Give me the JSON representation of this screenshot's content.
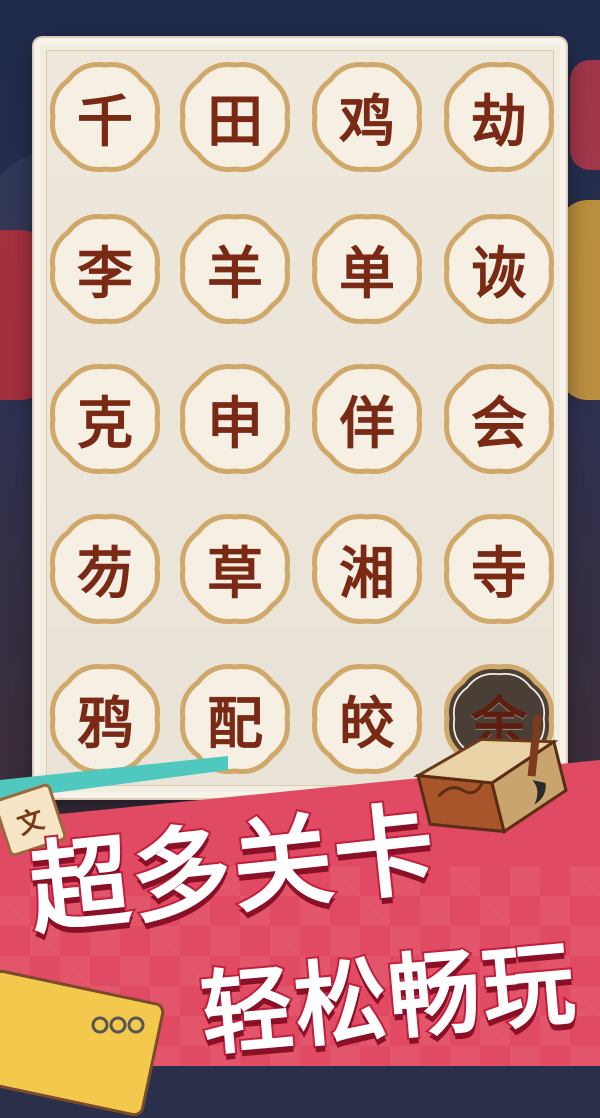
{
  "board": {
    "rows": [
      [
        "千",
        "田",
        "鸡",
        "劫"
      ],
      [
        "李",
        "羊",
        "单",
        "诙"
      ],
      [
        "克",
        "申",
        "佯",
        "会"
      ],
      [
        "芴",
        "草",
        "湘",
        "寺"
      ],
      [
        "鸦",
        "配",
        "皎",
        "余"
      ]
    ],
    "selected_char": "余"
  },
  "badge_char": "文",
  "banner": {
    "line1": "超多关卡",
    "line2": "轻松畅玩"
  }
}
